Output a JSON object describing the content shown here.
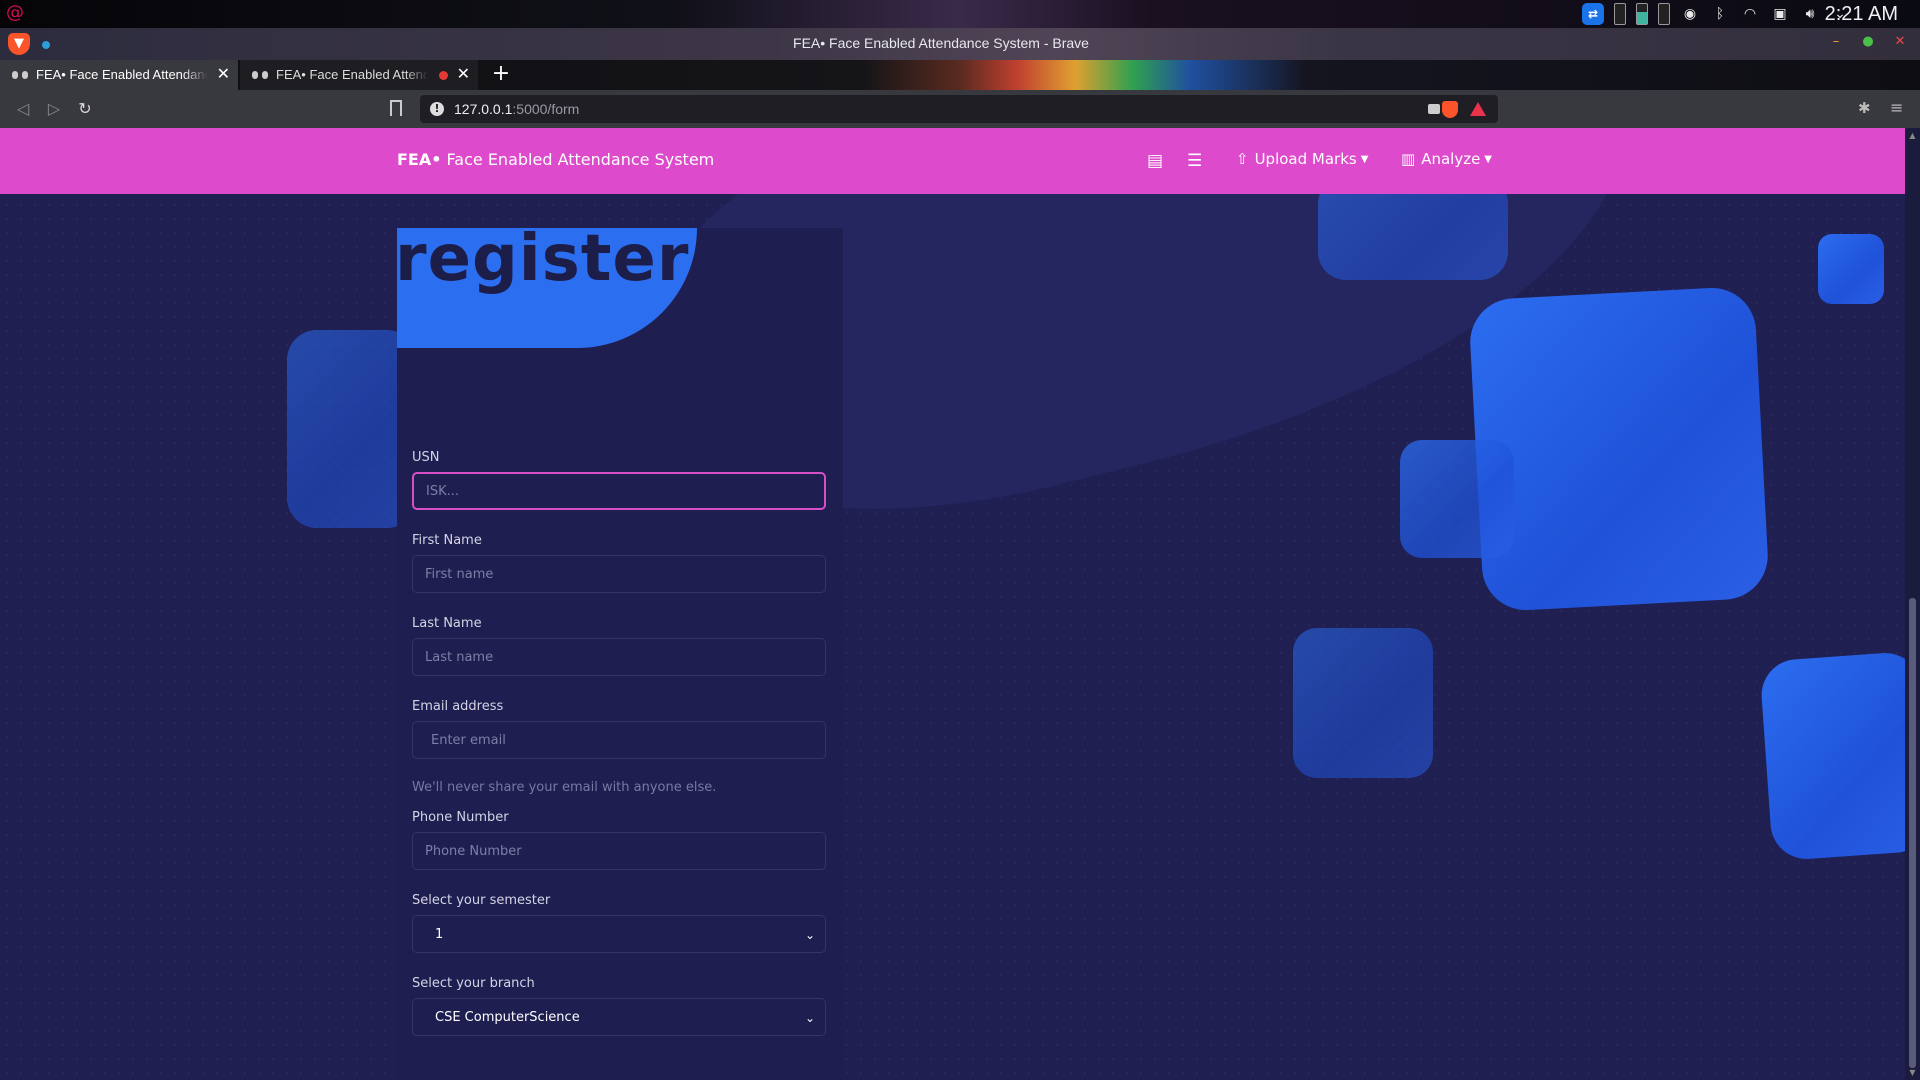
{
  "os": {
    "clock": "2:21 AM",
    "tray_icons": [
      "teamviewer-icon",
      "battery-icon",
      "bluetooth-icon",
      "wifi-icon",
      "screen-icon",
      "volume-icon",
      "chevron-down-icon"
    ]
  },
  "browser": {
    "window_title": "FEA• Face Enabled Attendance System - Brave",
    "tabs": [
      {
        "label": "FEA• Face Enabled Attendance System",
        "active": true
      },
      {
        "label": "FEA• Face Enabled Attendance System",
        "active": false,
        "recording": true
      }
    ],
    "url_host": "127.0.0.1",
    "url_path": ":5000/form"
  },
  "navbar": {
    "brand_bold": "FEA•",
    "brand_rest": " Face Enabled Attendance System",
    "upload_label": "Upload Marks",
    "analyze_label": "Analyze"
  },
  "form": {
    "title": "register",
    "usn": {
      "label": "USN",
      "placeholder": "ISK...",
      "value": ""
    },
    "first_name": {
      "label": "First Name",
      "placeholder": "First name"
    },
    "last_name": {
      "label": "Last Name",
      "placeholder": "Last name"
    },
    "email": {
      "label": "Email address",
      "placeholder": "Enter email",
      "help": "We'll never share your email with anyone else."
    },
    "phone": {
      "label": "Phone Number",
      "placeholder": "Phone Number"
    },
    "semester": {
      "label": "Select your semester",
      "selected": "1"
    },
    "branch": {
      "label": "Select your branch",
      "selected": "CSE ComputerScience"
    }
  },
  "colors": {
    "navbar": "#dd4acb",
    "page_bg": "#1f1f52",
    "accent_blue": "#2b6ff0",
    "focus_border": "#d64fc6"
  }
}
